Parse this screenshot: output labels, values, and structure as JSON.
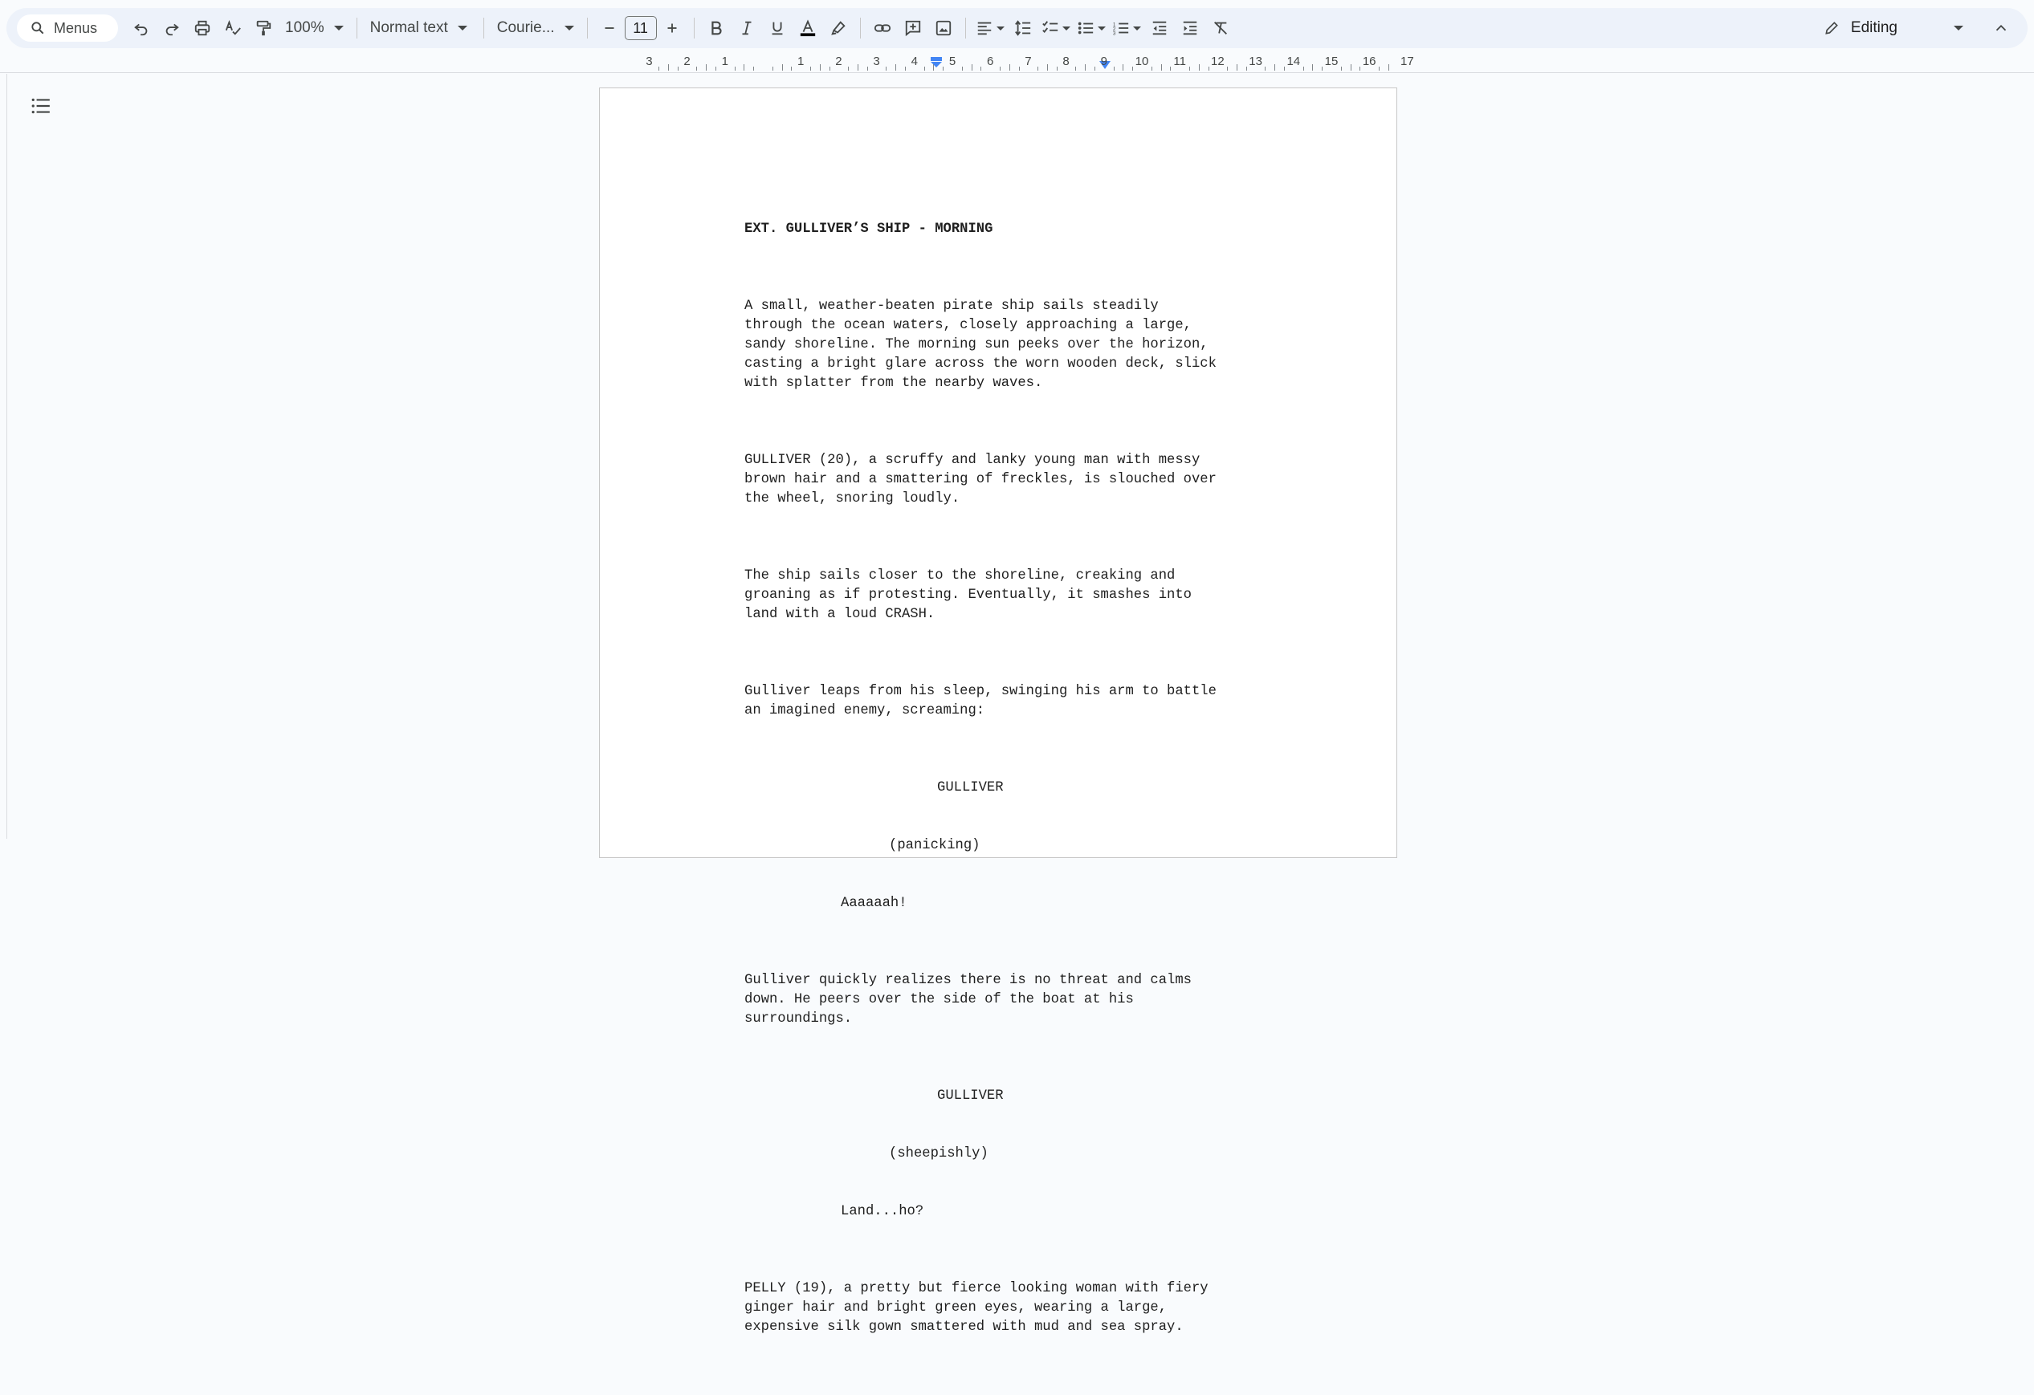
{
  "toolbar": {
    "search_label": "Menus",
    "zoom": "100%",
    "style": "Normal text",
    "font": "Courie...",
    "font_size": "11",
    "mode": "Editing",
    "text_color": "#000000"
  },
  "ruler": {
    "labels": [
      "3",
      "2",
      "1",
      "1",
      "2",
      "3",
      "4",
      "5",
      "6",
      "7",
      "8",
      "9",
      "10",
      "11",
      "12",
      "13",
      "14",
      "15",
      "16",
      "17"
    ]
  },
  "document": {
    "heading": "EXT. GULLIVER’S SHIP - MORNING",
    "action1": "A small, weather-beaten pirate ship sails steadily\nthrough the ocean waters, closely approaching a large,\nsandy shoreline. The morning sun peeks over the horizon,\ncasting a bright glare across the worn wooden deck, slick\nwith splatter from the nearby waves.",
    "action2": "GULLIVER (20), a scruffy and lanky young man with messy\nbrown hair and a smattering of freckles, is slouched over\nthe wheel, snoring loudly.",
    "action3": "The ship sails closer to the shoreline, creaking and\ngroaning as if protesting. Eventually, it smashes into\nland with a loud CRASH.",
    "action4": "Gulliver leaps from his sleep, swinging his arm to battle\nan imagined enemy, screaming:",
    "char1": "GULLIVER",
    "paren1": "(panicking)",
    "dialogue1": "Aaaaaah!",
    "action5": "Gulliver quickly realizes there is no threat and calms\ndown. He peers over the side of the boat at his\nsurroundings.",
    "char2": "GULLIVER",
    "paren2": "(sheepishly)",
    "dialogue2": "Land...ho?",
    "action6": "PELLY (19), a pretty but fierce looking woman with fiery\nginger hair and bright green eyes, wearing a large,\nexpensive silk gown smattered with mud and sea spray."
  }
}
